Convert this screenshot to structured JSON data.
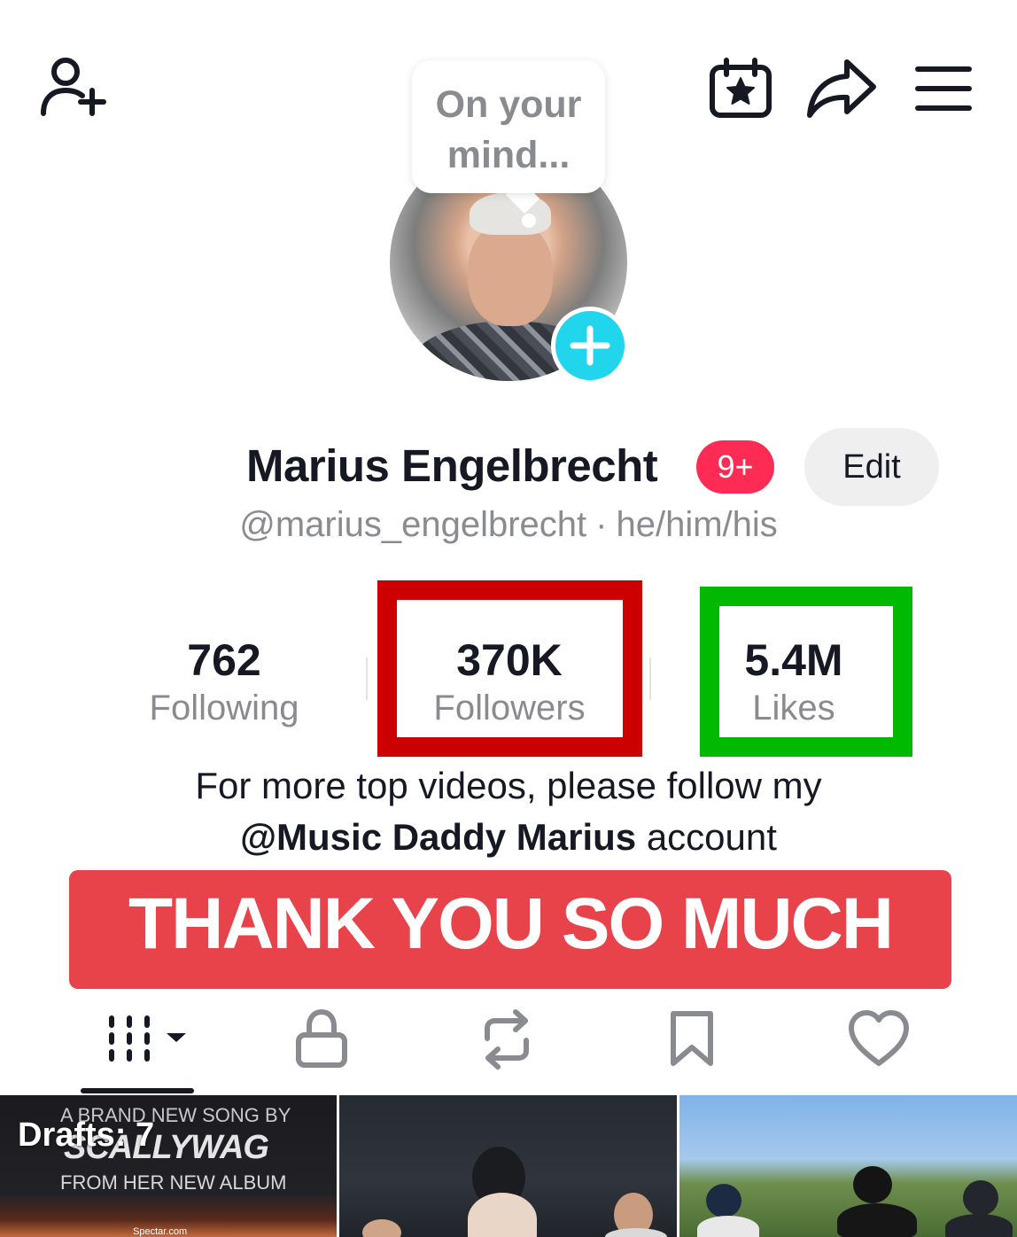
{
  "bubble": {
    "text_line1": "On your",
    "text_line2": "mind..."
  },
  "profile": {
    "display_name": "Marius Engelbrecht",
    "notification_badge": "9+",
    "edit_label": "Edit",
    "handle": "@marius_engelbrecht",
    "separator": "·",
    "pronouns": "he/him/his"
  },
  "stats": {
    "following": {
      "value": "762",
      "label": "Following"
    },
    "followers": {
      "value": "370K",
      "label": "Followers"
    },
    "likes": {
      "value": "5.4M",
      "label": "Likes"
    }
  },
  "bio": {
    "line1": "For more top videos, please follow my",
    "mention": "@Music Daddy Marius",
    "line2_suffix": "account"
  },
  "banner": {
    "text": "THANK YOU SO MUCH"
  },
  "highlight_colors": {
    "followers_box": "#cc0000",
    "likes_box": "#00b900",
    "banner_bg": "#e8424a",
    "avatar_add": "#20d5ec",
    "badge": "#fe2c55"
  },
  "tabs": [
    "videos-grid-icon",
    "private-lock-icon",
    "reposts-icon",
    "saved-bookmark-icon",
    "liked-heart-icon"
  ],
  "grid": {
    "first_thumb": {
      "overlay_label": "Drafts: 7",
      "line1": "A BRAND NEW SONG BY",
      "line2": "SCALLYWAG",
      "line3": "FROM HER NEW ALBUM",
      "site": "Spectar.com"
    }
  }
}
